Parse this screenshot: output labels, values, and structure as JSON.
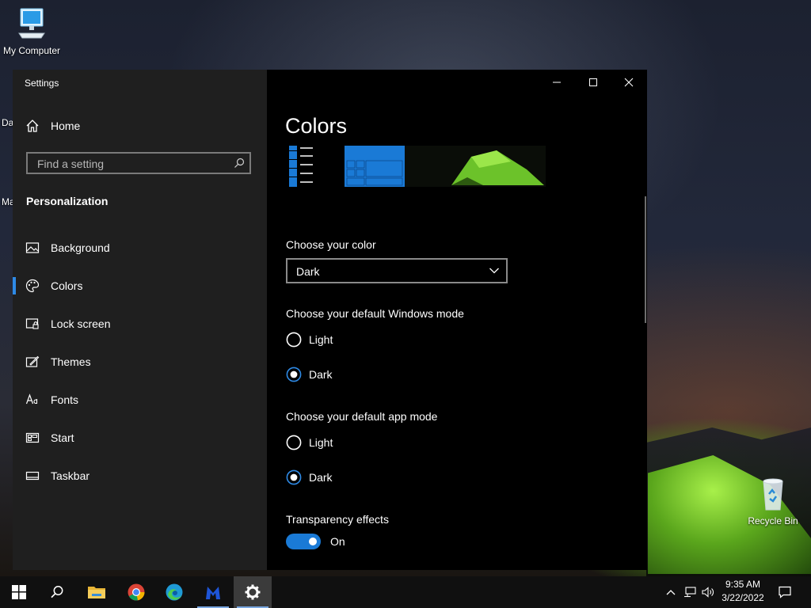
{
  "desktop": {
    "icons": [
      {
        "label": "My Computer"
      },
      {
        "label": "Recycle Bin"
      }
    ],
    "side_fragments": [
      "Da",
      "Ma"
    ]
  },
  "window": {
    "title": "Settings",
    "controls": {
      "minimize": "minimize-icon",
      "maximize": "maximize-icon",
      "close": "close-icon"
    }
  },
  "sidebar": {
    "home_label": "Home",
    "search_placeholder": "Find a setting",
    "section_title": "Personalization",
    "items": [
      {
        "label": "Background",
        "icon": "picture-icon",
        "selected": false
      },
      {
        "label": "Colors",
        "icon": "palette-icon",
        "selected": true
      },
      {
        "label": "Lock screen",
        "icon": "lock-screen-icon",
        "selected": false
      },
      {
        "label": "Themes",
        "icon": "themes-icon",
        "selected": false
      },
      {
        "label": "Fonts",
        "icon": "fonts-icon",
        "selected": false
      },
      {
        "label": "Start",
        "icon": "start-icon",
        "selected": false
      },
      {
        "label": "Taskbar",
        "icon": "taskbar-icon",
        "selected": false
      }
    ]
  },
  "main": {
    "page_title": "Colors",
    "choose_color": {
      "label": "Choose your color",
      "value": "Dark",
      "options": [
        "Dark"
      ]
    },
    "windows_mode": {
      "label": "Choose your default Windows mode",
      "options": [
        "Light",
        "Dark"
      ],
      "selected": "Dark"
    },
    "app_mode": {
      "label": "Choose your default app mode",
      "options": [
        "Light",
        "Dark"
      ],
      "selected": "Dark"
    },
    "transparency": {
      "label": "Transparency effects",
      "state_label": "On",
      "on": true
    }
  },
  "taskbar": {
    "apps": [
      {
        "name": "start",
        "icon": "windows-logo-icon"
      },
      {
        "name": "search",
        "icon": "search-icon"
      },
      {
        "name": "file-explorer",
        "icon": "folder-icon"
      },
      {
        "name": "chrome",
        "icon": "chrome-icon"
      },
      {
        "name": "edge",
        "icon": "edge-icon"
      },
      {
        "name": "malwarebytes",
        "icon": "malwarebytes-icon"
      },
      {
        "name": "settings",
        "icon": "gear-icon"
      }
    ],
    "clock": {
      "time": "9:35 AM",
      "date": "3/22/2022"
    }
  },
  "colors": {
    "accent": "#1a7ad6",
    "selection_bar": "#2e8ae6",
    "sidebar_bg": "#1f1f1f",
    "content_bg": "#000000"
  }
}
